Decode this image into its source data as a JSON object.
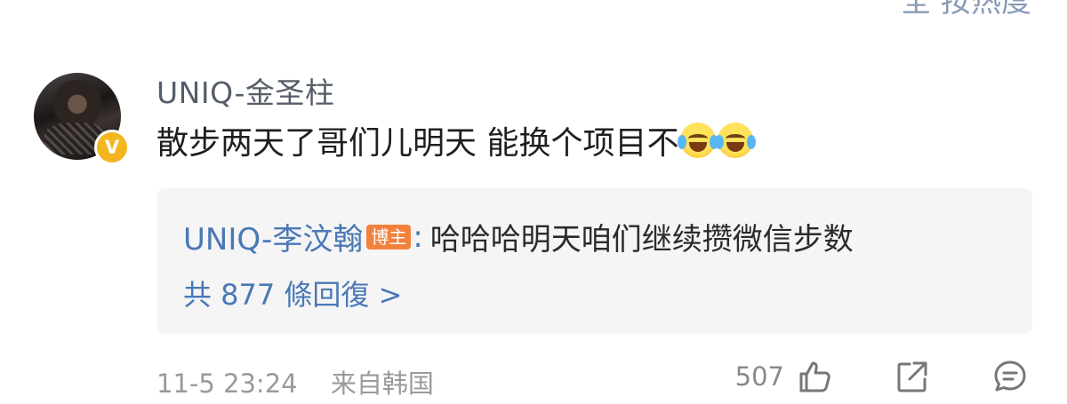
{
  "top_partial_text": "全 按热度",
  "comment": {
    "username": "UNIQ-金圣柱",
    "verified_badge": "V",
    "text": "散步两天了哥们儿明天 能换个项目不",
    "emojis": [
      "laughing-crying-emoji",
      "laughing-crying-emoji"
    ],
    "reply_preview": {
      "author": "UNIQ-李汶翰",
      "author_badge": "博主",
      "colon": ":",
      "content": "哈哈哈明天咱们继续攒微信步数",
      "count_text": "共 877 條回復 >"
    },
    "timestamp": "11-5 23:24",
    "source": "来自韩国",
    "like_count": "507"
  },
  "colors": {
    "link_blue": "#4a78b6",
    "badge_orange": "#f2813d",
    "verified_gold": "#f4b61f",
    "reply_bg": "#f5f5f5",
    "meta_gray": "#9a9a9a"
  },
  "icons": [
    "thumbs-up-icon",
    "share-icon",
    "comment-icon"
  ]
}
